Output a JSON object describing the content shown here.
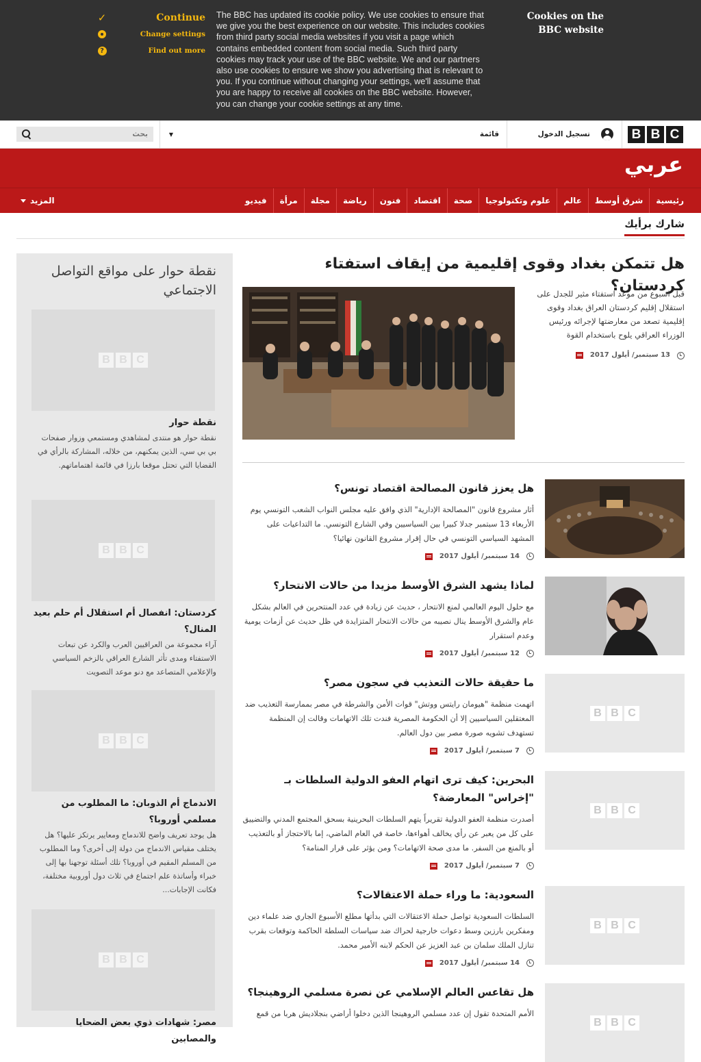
{
  "cookie_banner": {
    "continue_label": "Continue",
    "change_settings_label": "Change settings",
    "find_out_more_label": "Find out more",
    "body_text": "The BBC has updated its cookie policy. We use cookies to ensure that we give you the best experience on our website. This includes cookies from third party social media websites if you visit a page which contains embedded content from social media. Such third party cookies may track your use of the BBC website. We and our partners also use cookies to ensure we show you advertising that is relevant to you. If you continue without changing your settings, we'll assume that you are happy to receive all cookies on the BBC website. However, you can change your cookie settings at any time.",
    "title": "Cookies on the BBC website"
  },
  "topbar": {
    "logo_letters": [
      "B",
      "B",
      "C"
    ],
    "signin_label": "تسجيل الدخول",
    "menu_label": "قائمة",
    "search_placeholder": "بحث"
  },
  "masthead": {
    "brand": "عربي"
  },
  "nav": {
    "items": [
      "رئيسية",
      "شرق أوسط",
      "عالم",
      "علوم وتكنولوجيا",
      "صحة",
      "اقتصاد",
      "فنون",
      "رياضة",
      "مجلة",
      "مرأة",
      "فيديو"
    ],
    "more_label": "المزيد"
  },
  "section": {
    "title": "شارك برأيك"
  },
  "lead": {
    "headline": "هل تتمكن بغداد وقوى إقليمية من إيقاف استفتاء كردستان؟",
    "summary": "قبل اسبوع من موعد استفتاء مثير للجدل على استقلال إقليم كردستان العراق بغداد وقوى إقليمية تصعد من معارضتها لإجرائه ورئيس الوزراء العراقي يلوح باستخدام القوة",
    "date": "13 سبتمبر/ أيلول 2017"
  },
  "placeholder_logo": [
    "B",
    "B",
    "C"
  ],
  "stories": [
    {
      "title": "هل يعزز قانون المصالحة اقتصاد تونس؟",
      "summary": "أثار مشروع قانون \"المصالحة الإدارية\" الذي وافق عليه مجلس النواب الشعب التونسي يوم الأربعاء 13 سبتمبر جدلا كبيرا بين السياسيين وفي الشارع التونسي. ما التداعيات على المشهد السياسي التونسي في حال إقرار مشروع القانون نهائيا؟",
      "date": "14 سبتمبر/ أيلول 2017"
    },
    {
      "title": "لماذا يشهد الشرق الأوسط مزيدا من حالات الانتحار؟",
      "summary": "مع حلول اليوم العالمي لمنع الانتحار ، حديث عن زيادة في عدد المنتحرين في العالم بشكل عام والشرق الأوسط ينال نصيبه من حالات الانتحار المتزايدة في ظل حديث عن أزمات يومية وعدم استقرار",
      "date": "12 سبتمبر/ أيلول 2017"
    },
    {
      "title": "ما حقيقة حالات التعذيب في سجون مصر؟",
      "summary": "اتهمت منظمة \"هيومان رايتس ووتش\" قوات الأمن والشرطة في مصر بممارسة التعذيب ضد المعتقلين السياسيين إلا أن الحكومة المصرية فندت تلك الاتهامات وقالت إن المنظمة تستهدف تشويه صورة مصر بين دول العالم.",
      "date": "7 سبتمبر/ أيلول 2017"
    },
    {
      "title": "البحرين: كيف ترى اتهام العفو الدولية السلطات بـ \"إخراس\" المعارضة؟",
      "summary": "أصدرت منظمة العفو الدولية تقريراً يتهم السلطات البحرينية بسحق المجتمع المدني والتضييق على كل من يعبر عن رأي يخالف أهواءها، خاصة في العام الماضي، إما بالاحتجاز أو بالتعذيب أو بالمنع من السفر. ما مدى صحة الاتهامات؟ ومن يؤثر على قرار المنامة؟",
      "date": "7 سبتمبر/ أيلول 2017"
    },
    {
      "title": "السعودية: ما وراء حملة الاعتقالات؟",
      "summary": "السلطات السعودية تواصل حملة الاعتقالات التي بدأتها مطلع الأسبوع الجاري ضد علماء دين ومفكرين بارزين وسط دعوات خارجية لحراك ضد سياسات السلطة الحاكمة وتوقعات بقرب تنازل الملك سلمان بن عبد العزيز عن الحكم لابنه الأمير محمد.",
      "date": "14 سبتمبر/ أيلول 2017"
    },
    {
      "title": "هل تقاعس العالم الإسلامي عن نصرة مسلمي الروهينجا؟",
      "summary": "الأمم المتحدة تقول إن عدد مسلمي الروهينجا الذين دخلوا أراضي بنجلاديش هربا من قمع",
      "date": ""
    }
  ],
  "sidebar": {
    "title": "نقطة حوار على مواقع التواصل الاجتماعي",
    "items": [
      {
        "heading": "نقطة حوار",
        "text": "نقطة حوار هو منتدى لمشاهدي ومستمعي وزوار صفحات بي بي سي، الذين يمكنهم، من خلاله، المشاركة بالرأي في القضايا التي تحتل موقعا بارزا في قائمة اهتماماتهم."
      },
      {
        "heading": "كردستان: انفصال أم استقلال أم حلم بعيد المنال؟",
        "text": "آراء مجموعة من العراقيين العرب والكرد عن تبعات الاستفتاء ومدى تأثر الشارع العراقي بالزخم السياسي والإعلامي المتصاعد مع دنو موعد التصويت"
      },
      {
        "heading": "الاندماج أم الذوبان: ما المطلوب من مسلمي أوروبا؟",
        "text": "هل يوجد تعريف واضح للاندماج ومعايير يرتكز عليها؟ هل يختلف مقياس الاندماج من دولة إلى أخرى؟ وما المطلوب من المسلم المقيم في أوروبا؟ تلك أسئلة توجهنا بها إلى خبراء وأساتذة علم اجتماع في ثلاث دول أوروبية مختلفة، فكانت الإجابات..."
      },
      {
        "heading": "مصر: شهادات ذوي بعض الضحايا والمصابين",
        "text": ""
      }
    ]
  },
  "colors": {
    "bbc_red": "#bb1919",
    "cookie_bg": "#323232",
    "cookie_accent": "#f5b80f"
  }
}
